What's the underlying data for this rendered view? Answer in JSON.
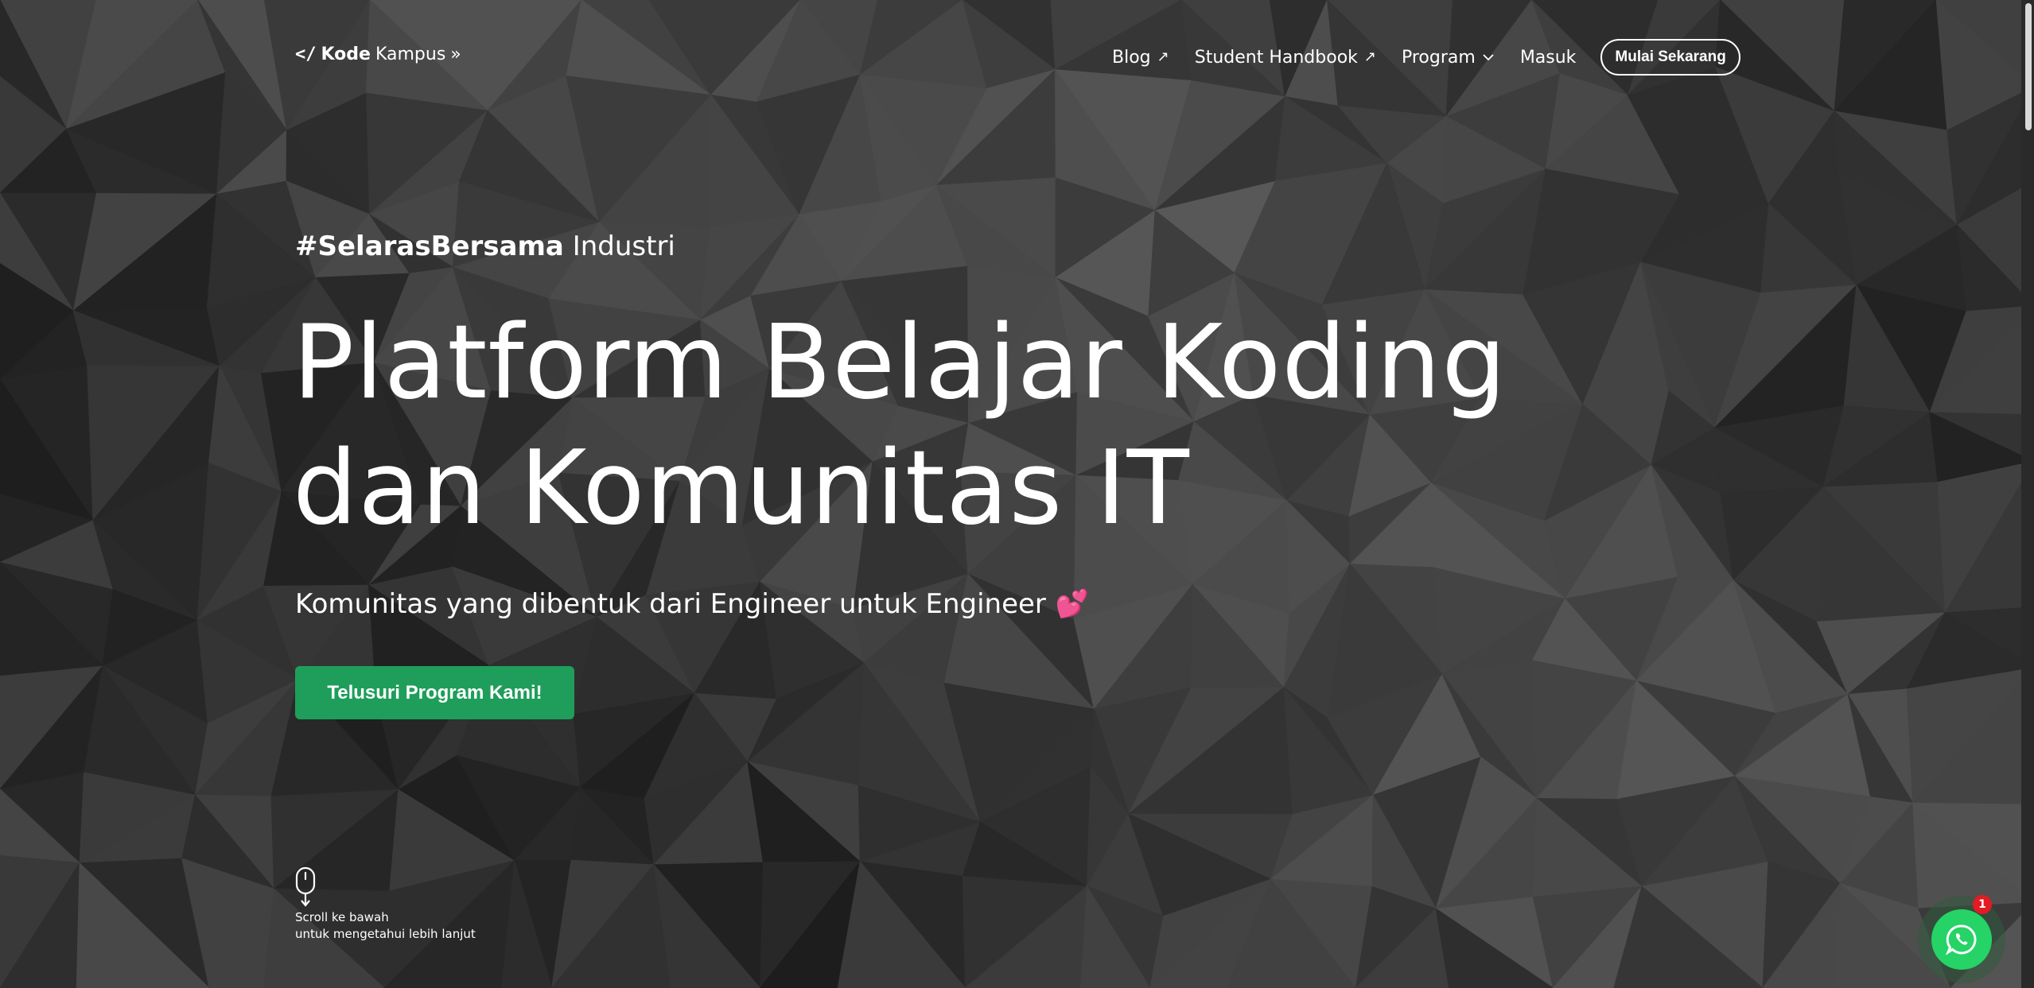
{
  "logo": {
    "tag": "</",
    "kode": "Kode",
    "kampus": "Kampus",
    "suffix": "»"
  },
  "nav": {
    "blog": "Blog",
    "blog_icon": "external-arrow-icon",
    "handbook": "Student Handbook",
    "handbook_icon": "external-arrow-icon",
    "program": "Program",
    "program_icon": "chevron-down-icon",
    "masuk": "Masuk",
    "cta": "Mulai Sekarang"
  },
  "hero": {
    "tagline_bold": "#SelarasBersama",
    "tagline_rest": "Industri",
    "headline_line1": "Platform Belajar Koding",
    "headline_line2": "dan Komunitas IT",
    "subtitle": "Komunitas yang dibentuk dari Engineer untuk Engineer",
    "subtitle_icon": "two-hearts-icon",
    "button": "Telusuri Program Kami!"
  },
  "scroll_hint": {
    "line1": "Scroll ke bawah",
    "line2": "untuk mengetahui lebih lanjut",
    "icon": "mouse-scroll-icon"
  },
  "whatsapp": {
    "badge": "1",
    "icon": "whatsapp-icon"
  },
  "colors": {
    "primary_green": "#1e9e5a",
    "whatsapp_green": "#25d366",
    "badge_red": "#e31b23",
    "heart_pink": "#e0245e",
    "background": "#2e2e2e"
  }
}
